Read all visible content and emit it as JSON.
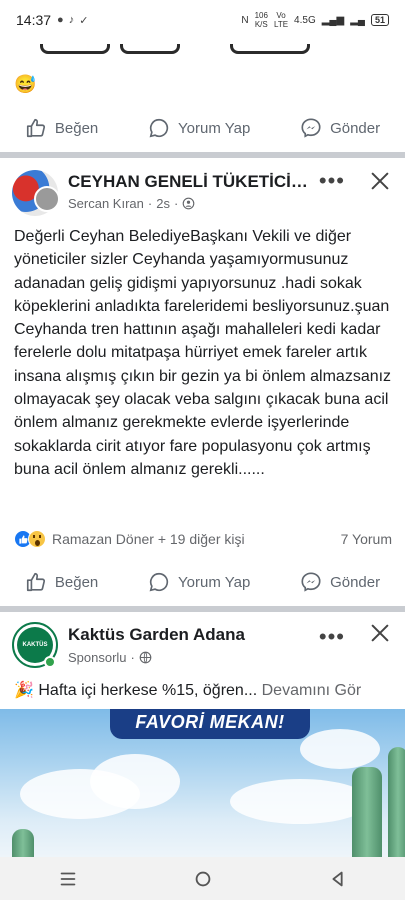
{
  "status_bar": {
    "time": "14:37",
    "net_speed_value": "106",
    "net_speed_unit": "K/S",
    "network_line1": "Vo",
    "network_line2": "LTE",
    "network_type": "4.5G",
    "battery": "51"
  },
  "previous_post": {
    "reaction_emoji": "😅",
    "actions": {
      "like": "Beğen",
      "comment": "Yorum Yap",
      "share": "Gönder"
    }
  },
  "post": {
    "page_name": "CEYHAN GENELİ TÜKETİCİ ...",
    "author": "Sercan Kıran",
    "time": "2s",
    "text": "Değerli Ceyhan BelediyeBaşkanı Vekili ve diğer yöneticiler sizler Ceyhanda yaşamıyormusunuz adanadan geliş gidişmi yapıyorsunuz .hadi sokak köpeklerini anladıkta fareleridemi besliyorsunuz.şuan Ceyhanda tren hattının aşağı mahalleleri kedi kadar ferelerle dolu mitatpaşa hürriyet emek fareler artık insana alışmış çıkın bir gezin ya bi önlem almazsanız olmayacak şey olacak veba salgını çıkacak buna acil önlem almanız gerekmekte evlerde işyerlerinde sokaklarda cirit atıyor fare populasyonu çok artmış buna acil önlem almanız gerekli......",
    "reactions_text": "Ramazan Döner + 19 diğer kişi",
    "comments_text": "7 Yorum",
    "actions": {
      "like": "Beğen",
      "comment": "Yorum Yap",
      "share": "Gönder"
    }
  },
  "sponsored_post": {
    "page_name": "Kaktüs Garden Adana",
    "avatar_text": "KAKTÜS",
    "label": "Sponsorlu",
    "emoji": "🎉",
    "text": "Hafta içi herkese %15, öğren...",
    "see_more": "Devamını Gör",
    "image_banner": "FAVORİ MEKAN!"
  },
  "colors": {
    "divider": "#c9ccd1",
    "secondary_text": "#65676b",
    "like_blue": "#1877f2",
    "sponsor_green": "#0c7a4a"
  }
}
